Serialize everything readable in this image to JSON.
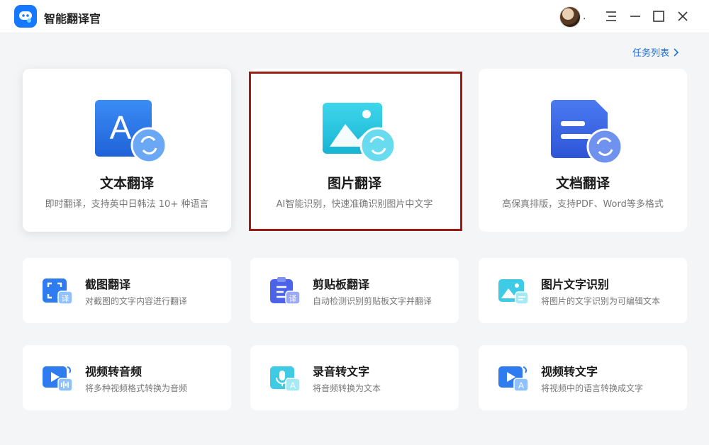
{
  "app": {
    "title": "智能翻译官"
  },
  "header": {
    "avatar_dot": "."
  },
  "task_link": {
    "label": "任务列表"
  },
  "big_cards": [
    {
      "title": "文本翻译",
      "desc": "即时翻译，支持英中日韩法 10+ 种语言",
      "icon": "text-translate-icon",
      "badge_letter": "A"
    },
    {
      "title": "图片翻译",
      "desc": "AI智能识别，快速准确识别图片中文字",
      "icon": "image-translate-icon"
    },
    {
      "title": "文档翻译",
      "desc": "高保真排版，支持PDF、Word等多格式",
      "icon": "document-translate-icon"
    }
  ],
  "small_cards": [
    {
      "title": "截图翻译",
      "desc": "对截图的文字内容进行翻译",
      "icon": "screenshot-translate-icon",
      "badge": "译"
    },
    {
      "title": "剪贴板翻译",
      "desc": "自动检测识别剪贴板文字并翻译",
      "icon": "clipboard-translate-icon",
      "badge": "译"
    },
    {
      "title": "图片文字识别",
      "desc": "将图片的文字识别为可编辑文本",
      "icon": "image-ocr-icon"
    },
    {
      "title": "视频转音频",
      "desc": "将多种视频格式转换为音频",
      "icon": "video-to-audio-icon"
    },
    {
      "title": "录音转文字",
      "desc": "将音频转换为文本",
      "icon": "audio-to-text-icon",
      "badge": "A"
    },
    {
      "title": "视频转文字",
      "desc": "将视频中的语言转换成文字",
      "icon": "video-to-text-icon",
      "badge": "A"
    }
  ],
  "colors": {
    "accent": "#1677ff",
    "highlight": "#9b1c14",
    "link": "#1e6fe0"
  }
}
